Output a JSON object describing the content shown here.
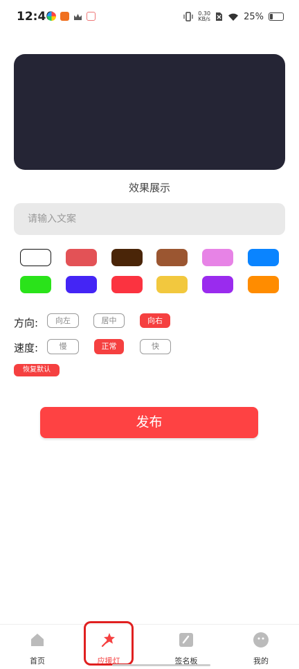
{
  "status_bar": {
    "time": "12:46",
    "speed_value": "0.30",
    "speed_unit": "KB/s",
    "battery": "25%"
  },
  "preview": {
    "label": "效果展示",
    "background": "#252535"
  },
  "text_input": {
    "placeholder": "请输入文案"
  },
  "colors": [
    "#ffffff",
    "#e35256",
    "#4a2508",
    "#9b5631",
    "#e783e6",
    "#0a84ff",
    "#2ae31a",
    "#4425f5",
    "#fb3340",
    "#f2c83e",
    "#9a2bee",
    "#ff8c00"
  ],
  "direction": {
    "label": "方向:",
    "options": [
      "向左",
      "居中",
      "向右"
    ],
    "selected": "向右"
  },
  "speed": {
    "label": "速度:",
    "options": [
      "慢",
      "正常",
      "快"
    ],
    "selected": "正常"
  },
  "reset_label": "恢复默认",
  "publish_label": "发布",
  "tabs": [
    {
      "label": "首页",
      "icon": "home-icon"
    },
    {
      "label": "应援灯",
      "icon": "star-wand-icon"
    },
    {
      "label": "签名板",
      "icon": "pen-board-icon"
    },
    {
      "label": "我的",
      "icon": "face-icon"
    }
  ],
  "active_tab": "应援灯",
  "accent_color": "#f54040"
}
